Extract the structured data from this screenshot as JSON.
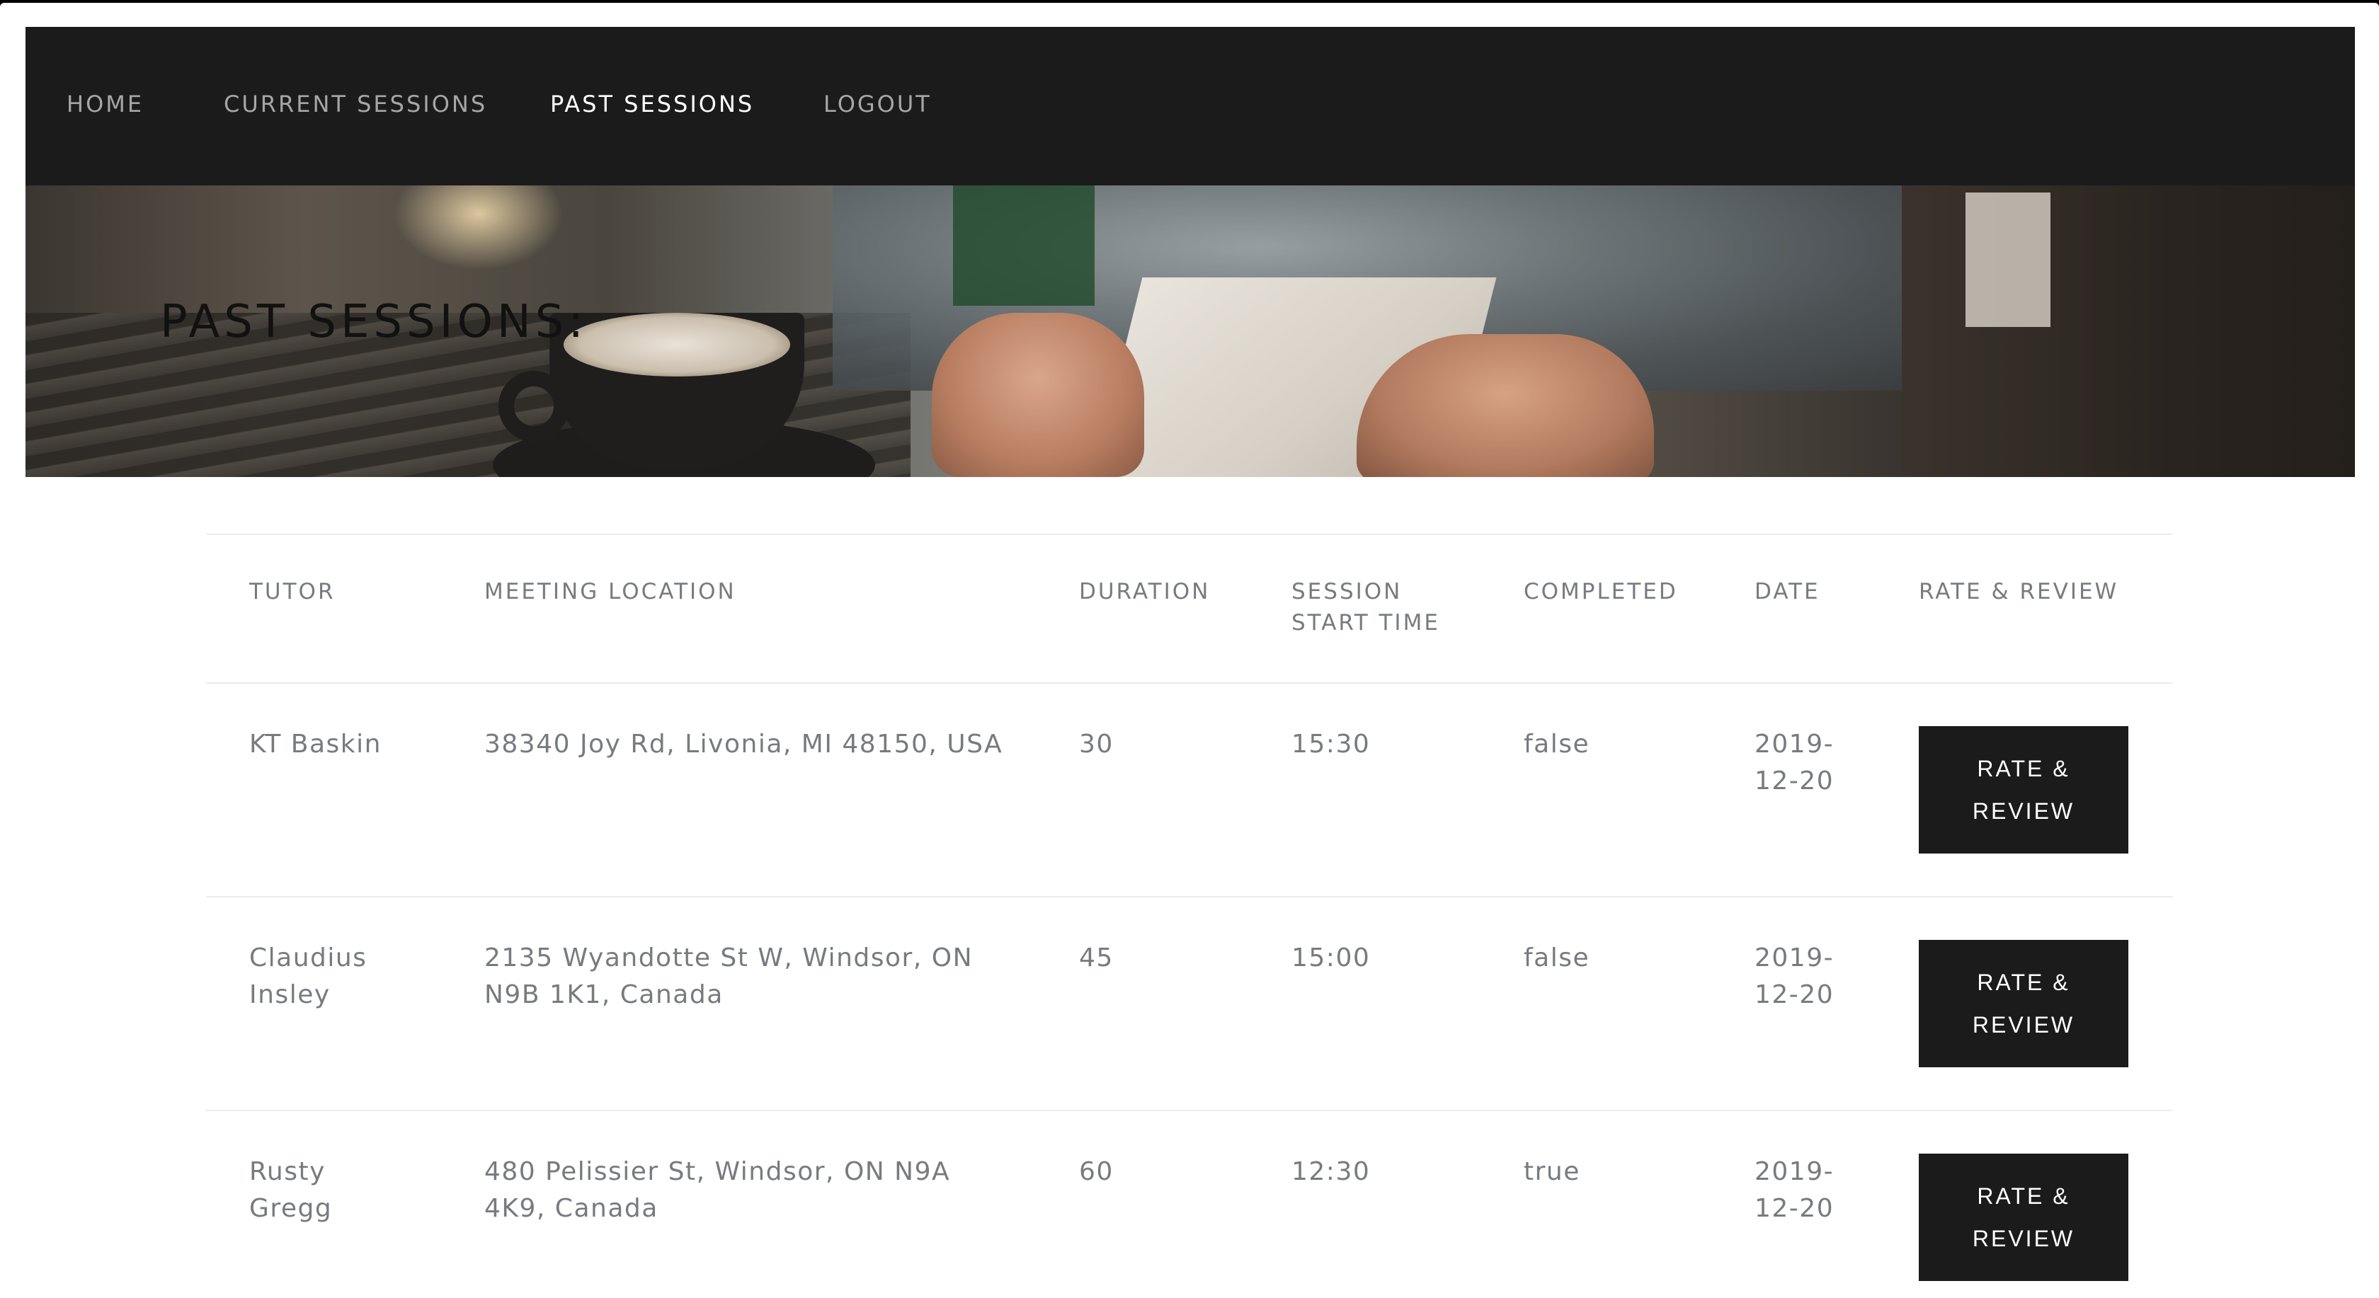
{
  "nav": {
    "home": "HOME",
    "current_sessions": "CURRENT SESSIONS",
    "past_sessions": "PAST SESSIONS",
    "logout": "LOGOUT",
    "active": "past_sessions"
  },
  "hero": {
    "title": "PAST SESSIONS:"
  },
  "table": {
    "headers": {
      "tutor": "TUTOR",
      "meeting_location": "MEETING LOCATION",
      "duration": "DURATION",
      "session_start_time_line1": "SESSION",
      "session_start_time_line2": "START TIME",
      "completed": "COMPLETED",
      "date": "DATE",
      "rate_review": "RATE & REVIEW"
    },
    "rows": [
      {
        "tutor_line1": "KT Baskin",
        "tutor_line2": "",
        "location_line1": "38340 Joy Rd, Livonia, MI 48150, USA",
        "location_line2": "",
        "duration": "30",
        "start_time": "15:30",
        "completed": "false",
        "date_line1": "2019-",
        "date_line2": "12-20",
        "button_line1": "RATE &",
        "button_line2": "REVIEW"
      },
      {
        "tutor_line1": "Claudius",
        "tutor_line2": "Insley",
        "location_line1": "2135 Wyandotte St W, Windsor, ON",
        "location_line2": "N9B 1K1, Canada",
        "duration": "45",
        "start_time": "15:00",
        "completed": "false",
        "date_line1": "2019-",
        "date_line2": "12-20",
        "button_line1": "RATE &",
        "button_line2": "REVIEW"
      },
      {
        "tutor_line1": "Rusty",
        "tutor_line2": "Gregg",
        "location_line1": "480 Pelissier St, Windsor, ON N9A",
        "location_line2": "4K9, Canada",
        "duration": "60",
        "start_time": "12:30",
        "completed": "true",
        "date_line1": "2019-",
        "date_line2": "12-20",
        "button_line1": "RATE &",
        "button_line2": "REVIEW"
      }
    ]
  },
  "colors": {
    "navbar_bg": "#1b1b1b",
    "nav_active": "#ffffff",
    "nav_inactive": "#a6a6a6",
    "table_text": "#777b80",
    "button_bg": "#1b1b1b",
    "button_text": "#ffffff"
  }
}
